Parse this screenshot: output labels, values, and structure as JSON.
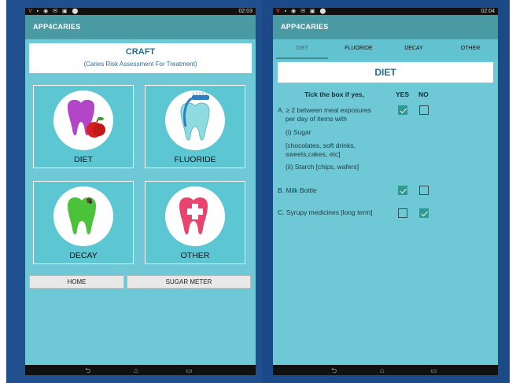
{
  "left": {
    "status_time": "02:03",
    "app_title": "APP4CARIES",
    "craft": {
      "title": "CRAFT",
      "subtitle": "(Caries Risk Assessment For Treatment)"
    },
    "tiles": [
      {
        "label": "DIET",
        "icon": "tooth-apple-icon"
      },
      {
        "label": "FLUORIDE",
        "icon": "tooth-toothbrush-icon"
      },
      {
        "label": "DECAY",
        "icon": "tooth-decay-icon"
      },
      {
        "label": "OTHER",
        "icon": "tooth-cross-icon"
      }
    ],
    "buttons": {
      "home": "HOME",
      "sugar_meter": "SUGAR METER"
    }
  },
  "right": {
    "status_time": "02:04",
    "app_title": "APP4CARIES",
    "tabs": [
      {
        "label": "DIET",
        "active": true
      },
      {
        "label": "FLUORIDE",
        "active": false
      },
      {
        "label": "DECAY",
        "active": false
      },
      {
        "label": "OTHER",
        "active": false
      }
    ],
    "banner": "DIET",
    "header": {
      "instruction": "Tick the box if yes,",
      "yes": "YES",
      "no": "NO"
    },
    "questions": {
      "a": {
        "lines": [
          "A. ≥ 2 between meal exposures",
          "per day of items with",
          "(i) Sugar",
          "[chocolates, soft drinks,",
          "sweets,cakes, etc]",
          "(ii) Starch [chips, wafers]"
        ],
        "yes": true,
        "no": false
      },
      "b": {
        "label": "B. Milk Bottle",
        "yes": true,
        "no": false
      },
      "c": {
        "label": "C. Syrupy medicines [long term]",
        "yes": false,
        "no": true
      }
    }
  },
  "colors": {
    "screen": "#6ec8d6",
    "appbar": "#4a9aa3",
    "frame": "#1f4f8f",
    "accent": "#2e9b91",
    "title_text": "#2a6d94"
  }
}
